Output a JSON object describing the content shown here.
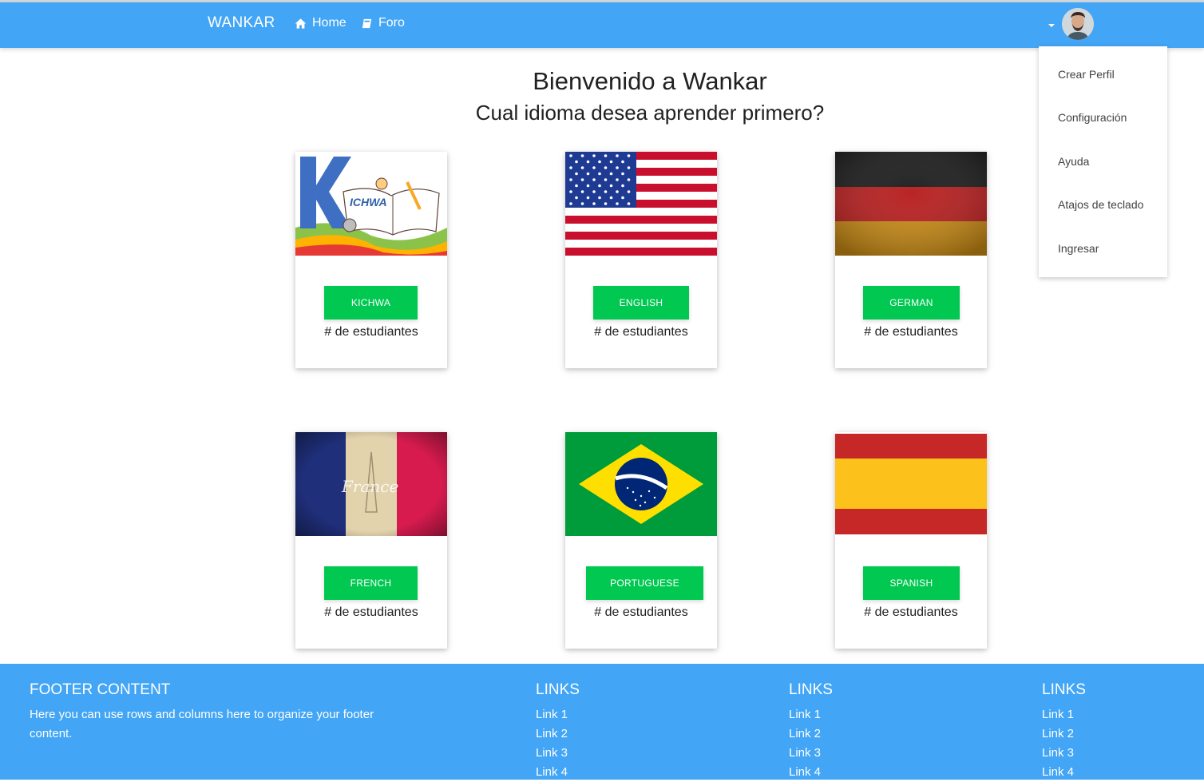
{
  "nav": {
    "brand": "WANKAR",
    "home_label": "Home",
    "foro_label": "Foro"
  },
  "dropdown": {
    "items": [
      "Crear Perfil",
      "Configuración",
      "Ayuda",
      "Atajos de teclado",
      "Ingresar"
    ]
  },
  "main": {
    "title": "Bienvenido a Wankar",
    "subtitle": "Cual idioma desea aprender primero?"
  },
  "cards": [
    {
      "button": "KICHWA",
      "count": "# de estudiantes",
      "image_text": "ICHWA"
    },
    {
      "button": "ENGLISH",
      "count": "# de estudiantes"
    },
    {
      "button": "GERMAN",
      "count": "# de estudiantes"
    },
    {
      "button": "FRENCH",
      "count": "# de estudiantes",
      "image_text": "France"
    },
    {
      "button": "PORTUGUESE",
      "count": "# de estudiantes"
    },
    {
      "button": "SPANISH",
      "count": "# de estudiantes"
    }
  ],
  "footer": {
    "heading": "FOOTER CONTENT",
    "text": "Here you can use rows and columns here to organize your footer content.",
    "columns": [
      {
        "heading": "LINKS",
        "links": [
          "Link 1",
          "Link 2",
          "Link 3",
          "Link 4"
        ]
      },
      {
        "heading": "LINKS",
        "links": [
          "Link 1",
          "Link 2",
          "Link 3",
          "Link 4"
        ]
      },
      {
        "heading": "LINKS",
        "links": [
          "Link 1",
          "Link 2",
          "Link 3",
          "Link 4"
        ]
      }
    ]
  },
  "colors": {
    "primary": "#42a5f5",
    "success": "#00c851"
  },
  "icons": [
    "home-icon",
    "book-icon",
    "caret-down-icon"
  ]
}
